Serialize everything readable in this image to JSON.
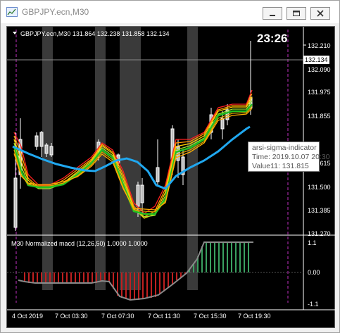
{
  "window": {
    "title": "GBPJPY.ecn,M30",
    "colors": {
      "titlebar": "#ffffff",
      "chart_bg": "#000000",
      "axis_text": "#ffffff"
    }
  },
  "chart_header": {
    "label": "GBPJPY.ecn,M30  131.864 132.238 131.858 132.134",
    "timer": "23:26"
  },
  "price_axis": {
    "ticks": [
      "132.210",
      "132.090",
      "131.975",
      "131.855",
      "131.735",
      "131.615",
      "131.500",
      "131.385",
      "131.270"
    ],
    "current_price": "132.134"
  },
  "macd_panel": {
    "label": "M30 Normalized macd (12,26,50) 1.0000 1.0000",
    "ticks": [
      "1.1",
      "0.00",
      "-1.1"
    ]
  },
  "time_axis": {
    "ticks": [
      "4 Oct 2019",
      "7 Oct 03:30",
      "7 Oct 07:30",
      "7 Oct 11:30",
      "7 Oct 15:30",
      "7 Oct 19:30"
    ]
  },
  "tooltip": {
    "line1": "arsi-sigma-indicator",
    "line2": "Time: 2019.10.07 20:30",
    "line3": "Value11: 131.815"
  },
  "chart_data": {
    "type": "line",
    "x": [
      "4 Oct 2019",
      "7 Oct 03:30",
      "7 Oct 07:30",
      "7 Oct 11:30",
      "7 Oct 15:30",
      "7 Oct 19:30"
    ],
    "series": [
      {
        "name": "arsi-sigma-indicator",
        "values": [
          131.69,
          131.66,
          131.7,
          131.53,
          131.69,
          131.82
        ]
      }
    ],
    "ylim": [
      131.27,
      132.21
    ],
    "macd": {
      "ylim": [
        -1.1,
        1.1
      ]
    }
  }
}
